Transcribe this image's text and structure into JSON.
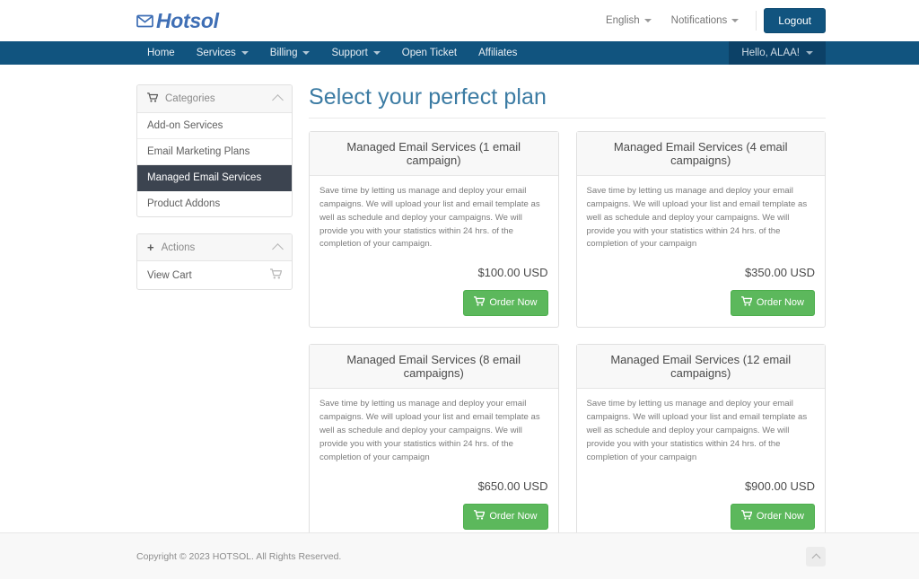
{
  "header": {
    "brand": "Hotsol",
    "brand_icon": "envelope-icon",
    "language": "English",
    "notifications": "Notifications",
    "logout": "Logout"
  },
  "navbar": {
    "items": [
      {
        "label": "Home",
        "has_caret": false
      },
      {
        "label": "Services",
        "has_caret": true
      },
      {
        "label": "Billing",
        "has_caret": true
      },
      {
        "label": "Support",
        "has_caret": true
      },
      {
        "label": "Open Ticket",
        "has_caret": false
      },
      {
        "label": "Affiliates",
        "has_caret": false
      }
    ],
    "user_greeting": "Hello, ALAA!"
  },
  "sidebar": {
    "categories": {
      "title": "Categories",
      "icon": "cart-icon",
      "items": [
        {
          "label": "Add-on Services",
          "active": false
        },
        {
          "label": "Email Marketing Plans",
          "active": false
        },
        {
          "label": "Managed Email Services",
          "active": true
        },
        {
          "label": "Product Addons",
          "active": false
        }
      ]
    },
    "actions": {
      "title": "Actions",
      "icon": "plus-icon",
      "items": [
        {
          "label": "View Cart",
          "icon": "cart-icon"
        }
      ]
    }
  },
  "main": {
    "title": "Select your perfect plan",
    "order_button_label": "Order Now",
    "products": [
      {
        "title": "Managed Email Services (1 email campaign)",
        "description": "Save time by letting us manage and deploy your email campaigns. We will upload your list and email template as well as schedule and deploy your campaigns. We will provide you with your statistics within 24 hrs. of the completion of your campaign.",
        "price": "$100.00 USD"
      },
      {
        "title": "Managed Email Services (4 email campaigns)",
        "description": "Save time by letting us manage and deploy your email campaigns. We will upload your list and email template as well as schedule and deploy your campaigns. We will provide you with your statistics within 24 hrs. of the completion of your campaign",
        "price": "$350.00 USD"
      },
      {
        "title": "Managed Email Services (8 email campaigns)",
        "description": "Save time by letting us manage and deploy your email campaigns. We will upload your list and email template as well as schedule and deploy your campaigns. We will provide you with your statistics within 24 hrs. of the completion of your campaign",
        "price": "$650.00 USD"
      },
      {
        "title": "Managed Email Services (12 email campaigns)",
        "description": "Save time by letting us manage and deploy your email campaigns. We will upload your list and email template as well as schedule and deploy your campaigns. We will provide you with your statistics within 24 hrs. of the completion of your campaign",
        "price": "$900.00 USD"
      }
    ]
  },
  "footer": {
    "copyright": "Copyright © 2023 HOTSOL. All Rights Reserved.",
    "scroll_top_icon": "chevron-up-icon"
  },
  "colors": {
    "navbar": "#11547f",
    "brand": "#3f6fb5",
    "accent_green": "#5cb85c",
    "active_sidebar": "#3c4450",
    "title_blue": "#3b7ba3"
  }
}
